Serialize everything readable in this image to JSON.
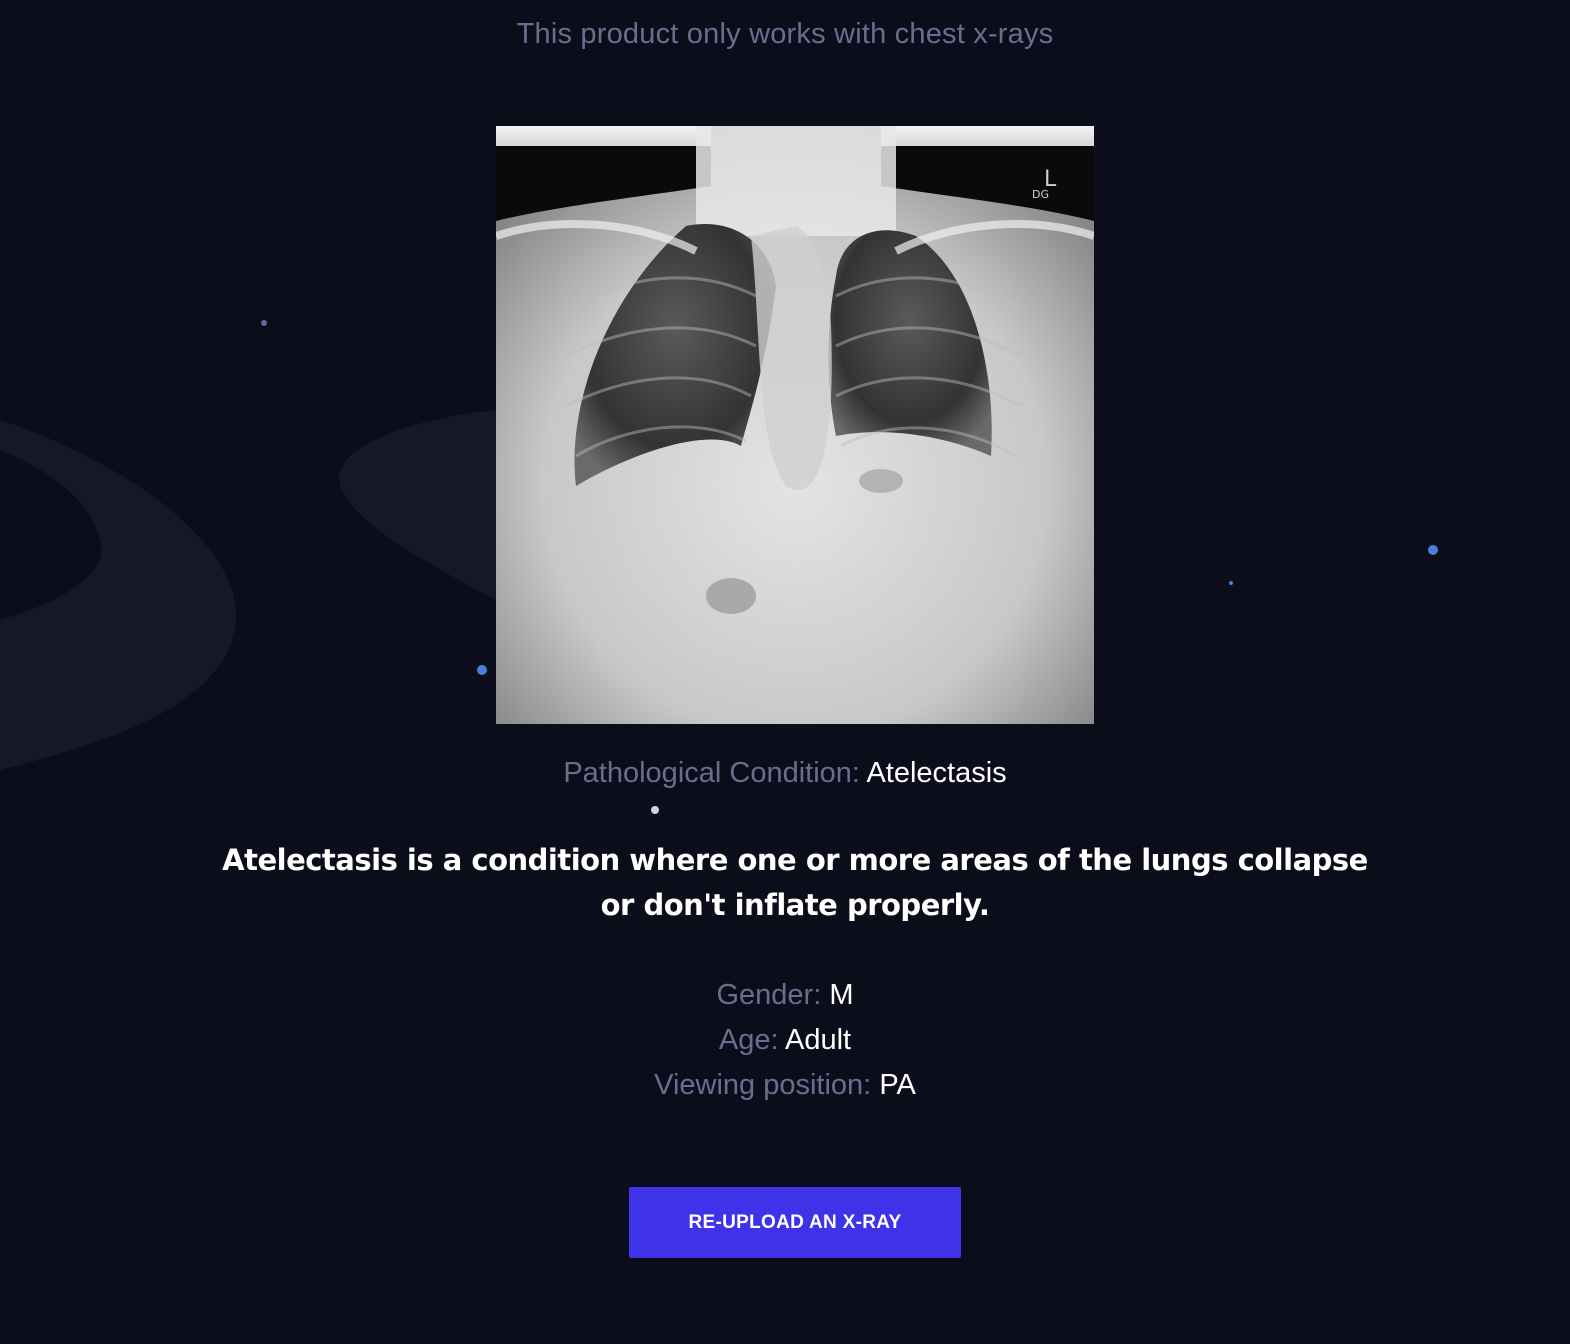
{
  "notice": "This product only works with chest x-rays",
  "image": {
    "alt": "chest-xray-image",
    "marker": "L",
    "marker_sub": "DG"
  },
  "result": {
    "condition_label": "Pathological Condition: ",
    "condition_value": "Atelectasis",
    "description": "Atelectasis is a condition where one or more areas of the lungs collapse or don't inflate properly."
  },
  "patient": {
    "gender_label": "Gender: ",
    "gender_value": "M",
    "age_label": "Age: ",
    "age_value": "Adult",
    "position_label": "Viewing position: ",
    "position_value": "PA"
  },
  "actions": {
    "reupload_label": "RE-UPLOAD AN X-RAY"
  },
  "colors": {
    "background": "#0c0d1a",
    "muted_text": "#6b6d8f",
    "accent": "#3e33e8",
    "dot": "#4a7fe0"
  }
}
